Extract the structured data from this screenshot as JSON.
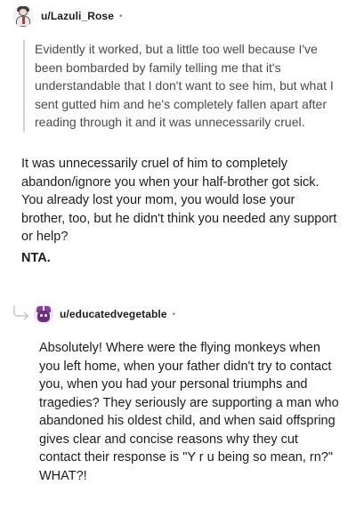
{
  "comment1": {
    "username": "u/Lazuli_Rose",
    "dot": "•",
    "quote": "Evidently it worked, but a little too well because I've been bombarded by family telling me that it's understandable that I don't want to see him, but what I sent gutted him and he's completely fallen apart after reading through it and it was unnecessarily cruel.",
    "body": "It was unnecessarily cruel of him to completely abandon/ignore you when your half-brother got sick. You already lost your mom, you would lose your brother, too, but he didn't think you needed any support or help?",
    "verdict": "NTA."
  },
  "comment2": {
    "username": "u/educatedvegetable",
    "dot": "•",
    "body": "Absolutely! Where were the flying monkeys when you left home, when your father didn't try to contact you, when you had your personal triumphs and tragedies? They seriously are supporting a man who abandoned his oldest child, and when said offspring gives clear and concise reasons why they cut contact their response is \"Y r u being so mean, rn?\" WHAT?!"
  },
  "icons": {
    "avatar1": "user-avatar-icon",
    "avatar2": "user-avatar-icon",
    "reply": "reply-arrow-icon"
  },
  "colors": {
    "text": "#1c1c1c",
    "quote_text": "#4a4a4a",
    "quote_bar": "#cfd2d4",
    "meta": "#878a8c",
    "reply_arrow": "#c7c9cb"
  }
}
